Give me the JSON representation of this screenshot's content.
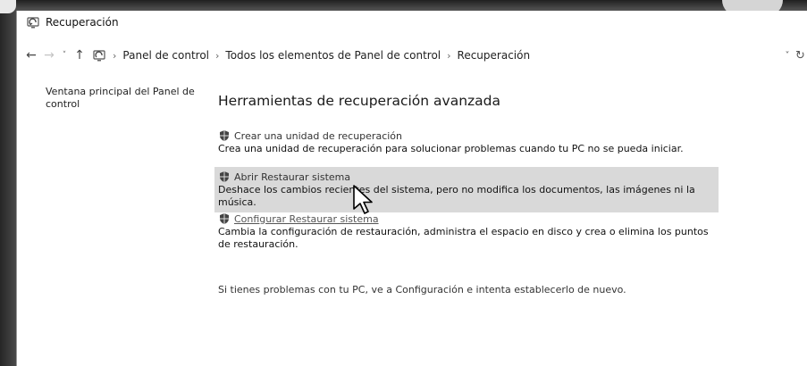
{
  "window": {
    "title": "Recuperación"
  },
  "nav": {
    "back": "←",
    "forward": "→",
    "recent": "˅",
    "up": "↑"
  },
  "breadcrumb": [
    "Panel de control",
    "Todos los elementos de Panel de control",
    "Recuperación"
  ],
  "addressbar": {
    "chevron": "˅",
    "refresh": "↻"
  },
  "sidebar": {
    "link": "Ventana principal del Panel de control"
  },
  "main": {
    "heading": "Herramientas de recuperación avanzada",
    "tasks": [
      {
        "title": "Crear una unidad de recuperación",
        "desc": "Crea una unidad de recuperación para solucionar problemas cuando tu PC no se pueda iniciar."
      },
      {
        "title": "Abrir Restaurar sistema",
        "desc": "Deshace los cambios recientes del sistema, pero no modifica los documentos, las imágenes ni la música."
      },
      {
        "title": "Configurar Restaurar sistema",
        "desc": "Cambia la configuración de restauración, administra el espacio en disco y crea o elimina los puntos de restauración."
      }
    ],
    "footnote": "Si tienes problemas con tu PC, ve a Configuración e intenta establecerlo de nuevo."
  },
  "icons": {
    "window": "recovery-icon",
    "shield": "uac-shield-icon",
    "cursor": "mouse-pointer-icon"
  },
  "colors": {
    "hover": "#d9d9d9",
    "text": "#111111",
    "link": "#555555"
  }
}
